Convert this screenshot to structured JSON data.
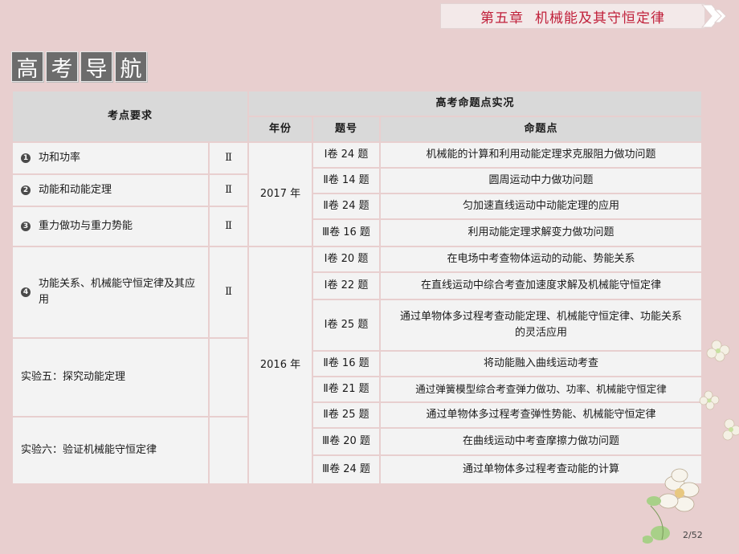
{
  "chapter": {
    "number": "第五章",
    "title": "机械能及其守恒定律"
  },
  "nav_title": [
    "高",
    "考",
    "导",
    "航"
  ],
  "table": {
    "header": {
      "requirements": "考点要求",
      "situation": "高考命题点实况",
      "year": "年份",
      "question": "题号",
      "point": "命题点"
    },
    "requirements": [
      {
        "marker": "1",
        "text": "功和功率",
        "level": "Ⅱ"
      },
      {
        "marker": "2",
        "text": "动能和动能定理",
        "level": "Ⅱ"
      },
      {
        "marker": "3",
        "text": "重力做功与重力势能",
        "level": "Ⅱ"
      },
      {
        "marker": "4",
        "text": "功能关系、机械能守恒定律及其应用",
        "level": "Ⅱ"
      },
      {
        "marker": "",
        "text": "实验五：探究动能定理",
        "level": ""
      },
      {
        "marker": "",
        "text": "实验六：验证机械能守恒定律",
        "level": ""
      }
    ],
    "years": [
      "2017 年",
      "2016 年"
    ],
    "rows": [
      {
        "question": "Ⅰ卷 24 题",
        "point": "机械能的计算和利用动能定理求克服阻力做功问题"
      },
      {
        "question": "Ⅱ卷 14 题",
        "point": "圆周运动中力做功问题"
      },
      {
        "question": "Ⅱ卷 24 题",
        "point": "匀加速直线运动中动能定理的应用"
      },
      {
        "question": "Ⅲ卷 16 题",
        "point": "利用动能定理求解变力做功问题"
      },
      {
        "question": "Ⅰ卷 20 题",
        "point": "在电场中考查物体运动的动能、势能关系"
      },
      {
        "question": "Ⅰ卷 22 题",
        "point": "在直线运动中综合考查加速度求解及机械能守恒定律"
      },
      {
        "question": "Ⅰ卷 25 题",
        "point": "通过单物体多过程考查动能定理、机械能守恒定律、功能关系的灵活应用"
      },
      {
        "question": "Ⅱ卷 16 题",
        "point": "将动能融入曲线运动考查"
      },
      {
        "question": "Ⅱ卷 21 题",
        "point": "通过弹簧模型综合考查弹力做功、功率、机械能守恒定律"
      },
      {
        "question": "Ⅱ卷 25 题",
        "point": "通过单物体多过程考查弹性势能、机械能守恒定律"
      },
      {
        "question": "Ⅲ卷 20 题",
        "point": "在曲线运动中考查摩擦力做功问题"
      },
      {
        "question": "Ⅲ卷 24 题",
        "point": "通过单物体多过程考查动能的计算"
      }
    ]
  },
  "page": "2/52",
  "colors": {
    "accent": "#c0203a",
    "background": "#e8cfcf",
    "header_cell": "#d9d9d9",
    "body_cell": "#f3f3f3"
  }
}
